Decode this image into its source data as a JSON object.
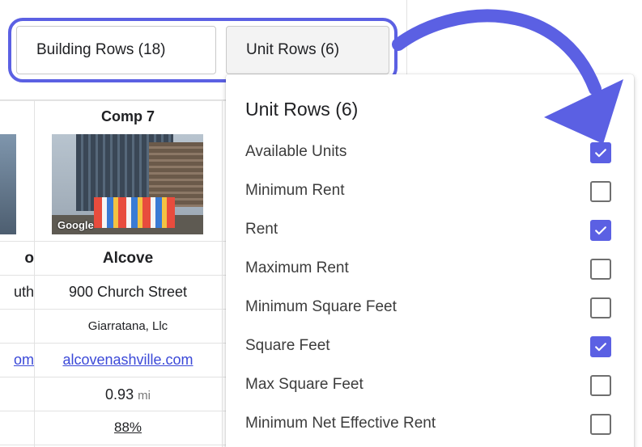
{
  "tabs": {
    "building_label": "Building Rows (18)",
    "unit_label": "Unit Rows (6)"
  },
  "dropdown": {
    "title": "Unit Rows (6)",
    "options": [
      {
        "label": "Available Units",
        "checked": true
      },
      {
        "label": "Minimum Rent",
        "checked": false
      },
      {
        "label": "Rent",
        "checked": true
      },
      {
        "label": "Maximum Rent",
        "checked": false
      },
      {
        "label": "Minimum Square Feet",
        "checked": false
      },
      {
        "label": "Square Feet",
        "checked": true
      },
      {
        "label": "Max Square Feet",
        "checked": false
      },
      {
        "label": "Minimum Net Effective Rent",
        "checked": false
      }
    ]
  },
  "comp_table": {
    "comp": {
      "header": "Comp 7",
      "photo_watermark": "Google",
      "name": "Alcove",
      "address": "900 Church Street",
      "owner": "Giarratana, Llc",
      "website": "alcovenashville.com",
      "distance": "0.93",
      "distance_unit": "mi",
      "occupancy": "88%"
    },
    "left_partial": {
      "name": "o",
      "address": "uth",
      "website": "om"
    }
  },
  "colors": {
    "accent": "#5b60e3",
    "link": "#3b49d8"
  },
  "icons": {
    "checkmark": "check-icon",
    "annotation": "curved-arrow-icon"
  }
}
